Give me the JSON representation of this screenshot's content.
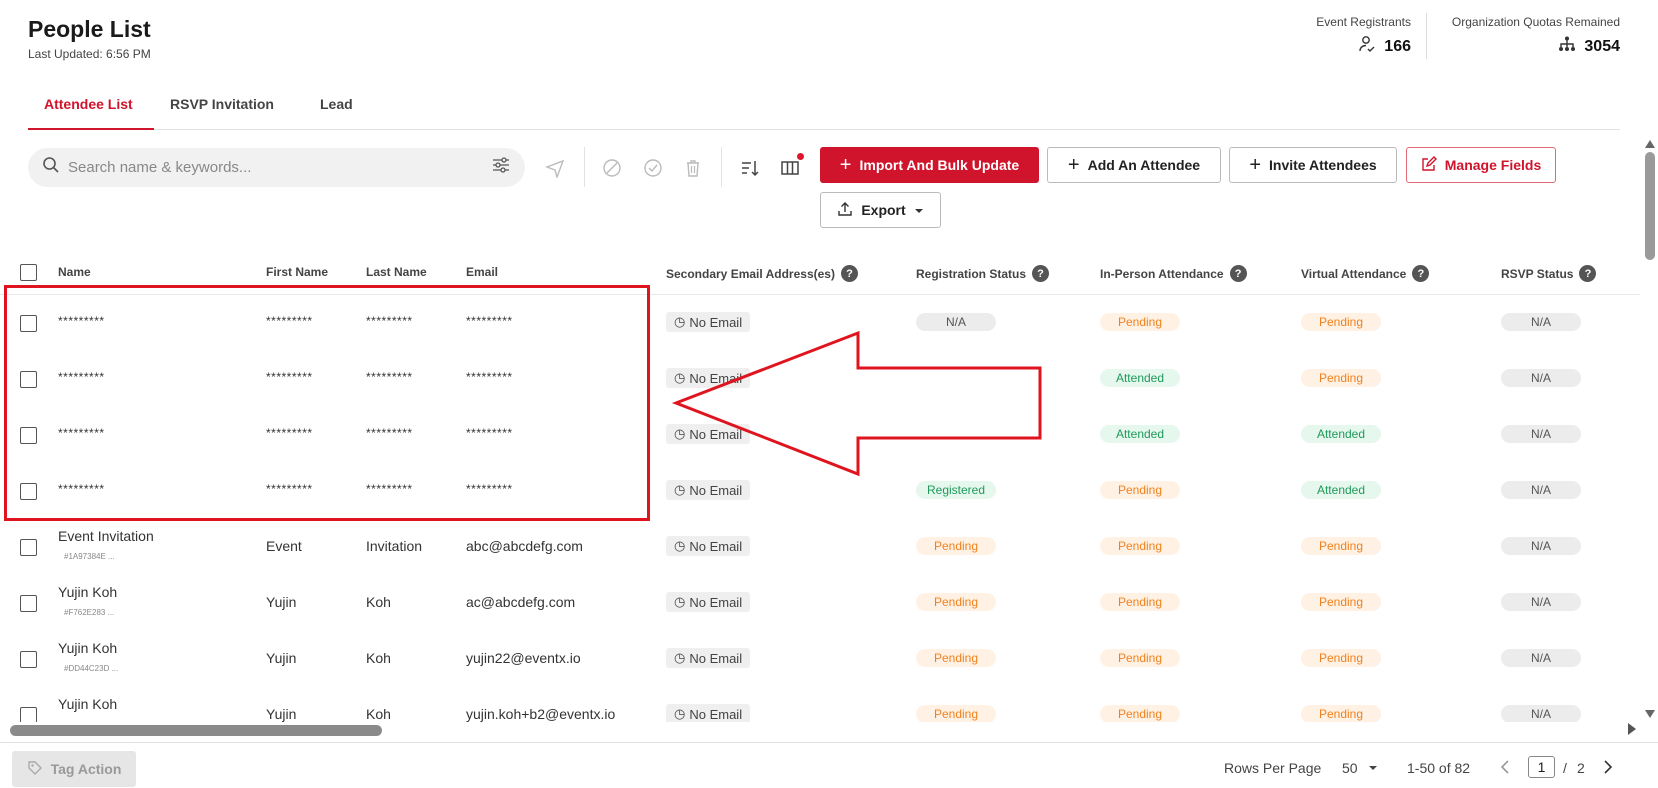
{
  "header": {
    "title": "People List",
    "last_updated": "Last Updated: 6:56 PM",
    "stats": [
      {
        "label": "Event Registrants",
        "value": "166",
        "icon": "user-check-icon"
      },
      {
        "label": "Organization Quotas Remained",
        "value": "3054",
        "icon": "org-chart-icon"
      }
    ]
  },
  "tabs": [
    {
      "label": "Attendee List",
      "active": true
    },
    {
      "label": "RSVP Invitation",
      "active": false
    },
    {
      "label": "Lead",
      "active": false
    }
  ],
  "search": {
    "placeholder": "Search name & keywords...",
    "value": ""
  },
  "toolbar": {
    "import_label": "Import And Bulk Update",
    "add_label": "Add An Attendee",
    "invite_label": "Invite Attendees",
    "manage_label": "Manage Fields",
    "export_label": "Export"
  },
  "columns": [
    "Name",
    "First Name",
    "Last Name",
    "Email",
    "Secondary Email Address(es)",
    "Registration Status",
    "In-Person Attendance",
    "Virtual Attendance",
    "RSVP Status"
  ],
  "rows": [
    {
      "name": "*********",
      "id": "",
      "first": "*********",
      "last": "*********",
      "email": "*********",
      "secondary": "No Email",
      "registration": "N/A",
      "inperson": "Pending",
      "virtual": "Pending",
      "rsvp": "N/A"
    },
    {
      "name": "*********",
      "id": "",
      "first": "*********",
      "last": "*********",
      "email": "*********",
      "secondary": "No Email",
      "registration": "",
      "inperson": "Attended",
      "virtual": "Pending",
      "rsvp": "N/A"
    },
    {
      "name": "*********",
      "id": "",
      "first": "*********",
      "last": "*********",
      "email": "*********",
      "secondary": "No Email",
      "registration": "",
      "inperson": "Attended",
      "virtual": "Attended",
      "rsvp": "N/A"
    },
    {
      "name": "*********",
      "id": "",
      "first": "*********",
      "last": "*********",
      "email": "*********",
      "secondary": "No Email",
      "registration": "Registered",
      "inperson": "Pending",
      "virtual": "Attended",
      "rsvp": "N/A"
    },
    {
      "name": "Event Invitation",
      "id": "#1A97384E ...",
      "first": "Event",
      "last": "Invitation",
      "email": "abc@abcdefg.com",
      "secondary": "No Email",
      "registration": "Pending",
      "inperson": "Pending",
      "virtual": "Pending",
      "rsvp": "N/A"
    },
    {
      "name": "Yujin Koh",
      "id": "#F762E283 ...",
      "first": "Yujin",
      "last": "Koh",
      "email": "ac@abcdefg.com",
      "secondary": "No Email",
      "registration": "Pending",
      "inperson": "Pending",
      "virtual": "Pending",
      "rsvp": "N/A"
    },
    {
      "name": "Yujin Koh",
      "id": "#DD44C23D ...",
      "first": "Yujin",
      "last": "Koh",
      "email": "yujin22@eventx.io",
      "secondary": "No Email",
      "registration": "Pending",
      "inperson": "Pending",
      "virtual": "Pending",
      "rsvp": "N/A"
    },
    {
      "name": "Yujin Koh",
      "id": "",
      "first": "Yujin",
      "last": "Koh",
      "email": "yujin.koh+b2@eventx.io",
      "secondary": "No Email",
      "registration": "Pending",
      "inperson": "Pending",
      "virtual": "Pending",
      "rsvp": "N/A"
    }
  ],
  "footer": {
    "tag_action": "Tag Action",
    "rows_per_page_label": "Rows Per Page",
    "rows_per_page": "50",
    "range": "1-50 of 82",
    "page": "1",
    "page_sep": "/",
    "total_pages": "2"
  },
  "colors": {
    "accent": "#d0142c",
    "annotation": "#e0141e"
  }
}
